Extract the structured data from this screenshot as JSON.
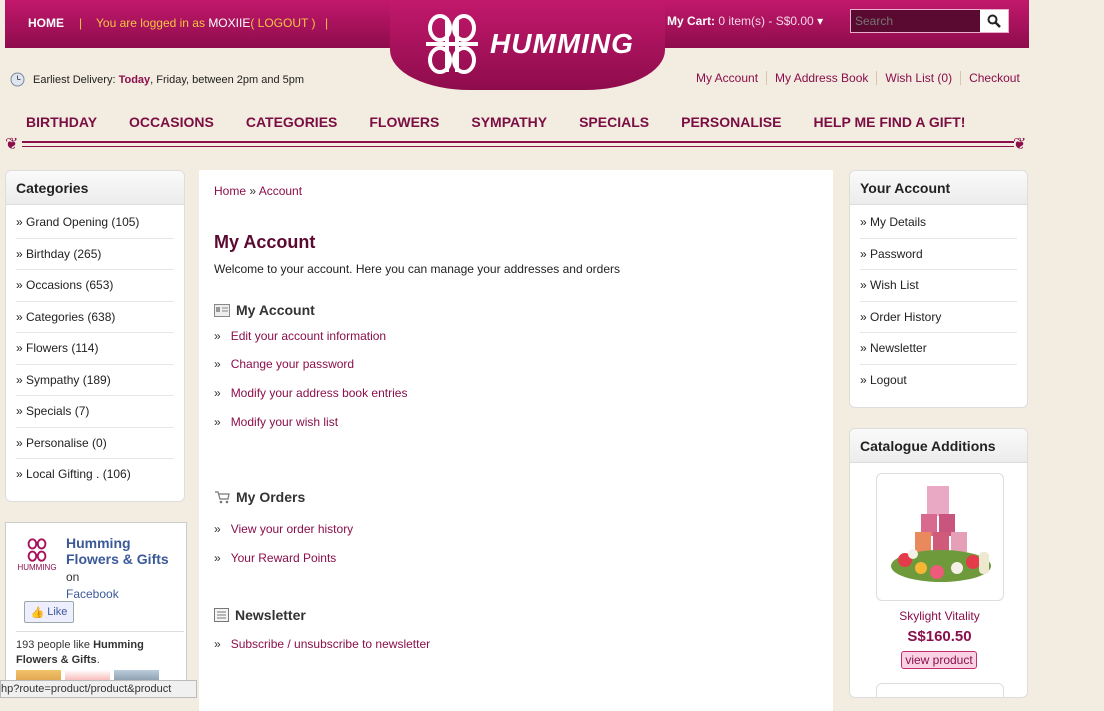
{
  "header": {
    "home": "HOME",
    "logged_prefix": "You are logged in as ",
    "username": "MOXIIE",
    "logout": "( LOGOUT )",
    "cart_label": "My Cart:",
    "cart_value": "0 item(s) - S$0.00",
    "search_placeholder": "Search",
    "logo_text": "HUMMING"
  },
  "delivery": {
    "label": "Earliest Delivery:",
    "today": "Today",
    "rest": ", Friday, between 2pm and 5pm"
  },
  "toplinks": [
    "My Account",
    "My Address Book",
    "Wish List (0)",
    "Checkout"
  ],
  "nav": [
    "BIRTHDAY",
    "OCCASIONS",
    "CATEGORIES",
    "FLOWERS",
    "SYMPATHY",
    "SPECIALS",
    "PERSONALISE",
    "HELP ME FIND A GIFT!"
  ],
  "categories": {
    "title": "Categories",
    "items": [
      "» Grand Opening (105)",
      "» Birthday (265)",
      "» Occasions (653)",
      "» Categories (638)",
      "» Flowers (114)",
      "» Sympathy (189)",
      "» Specials (7)",
      "» Personalise (0)",
      "» Local Gifting . (106)"
    ]
  },
  "facebook": {
    "logo_text": "HUMMING",
    "page_name": "Humming Flowers & Gifts",
    "on": " on",
    "network": "Facebook",
    "like": "Like",
    "count_text": "193 people like ",
    "count_name": "Humming Flowers & Gifts",
    "count_end": "."
  },
  "status_url": "hp?route=product/product&product",
  "main": {
    "crumb_home": "Home",
    "crumb_sep": " » ",
    "crumb_account": "Account",
    "title": "My Account",
    "welcome": "Welcome to your account. Here you can manage your addresses and orders",
    "sections": [
      {
        "title": "My Account",
        "links": [
          "Edit your account information",
          "Change your password",
          "Modify your address book entries",
          "Modify your wish list"
        ]
      },
      {
        "title": "My Orders",
        "links": [
          "View your order history",
          "Your Reward Points"
        ]
      },
      {
        "title": "Newsletter",
        "links": [
          "Subscribe / unsubscribe to newsletter"
        ]
      }
    ],
    "bullet": "»"
  },
  "your_account": {
    "title": "Your Account",
    "items": [
      "» My Details",
      "» Password",
      "» Wish List",
      "» Order History",
      "» Newsletter",
      "» Logout"
    ]
  },
  "catalogue": {
    "title": "Catalogue Additions",
    "product_name": "Skylight Vitality",
    "price": "S$160.50",
    "button": "view product"
  },
  "colors": {
    "brand": "#a8125c",
    "accent": "#f5c542",
    "background": "#f3ece0"
  }
}
